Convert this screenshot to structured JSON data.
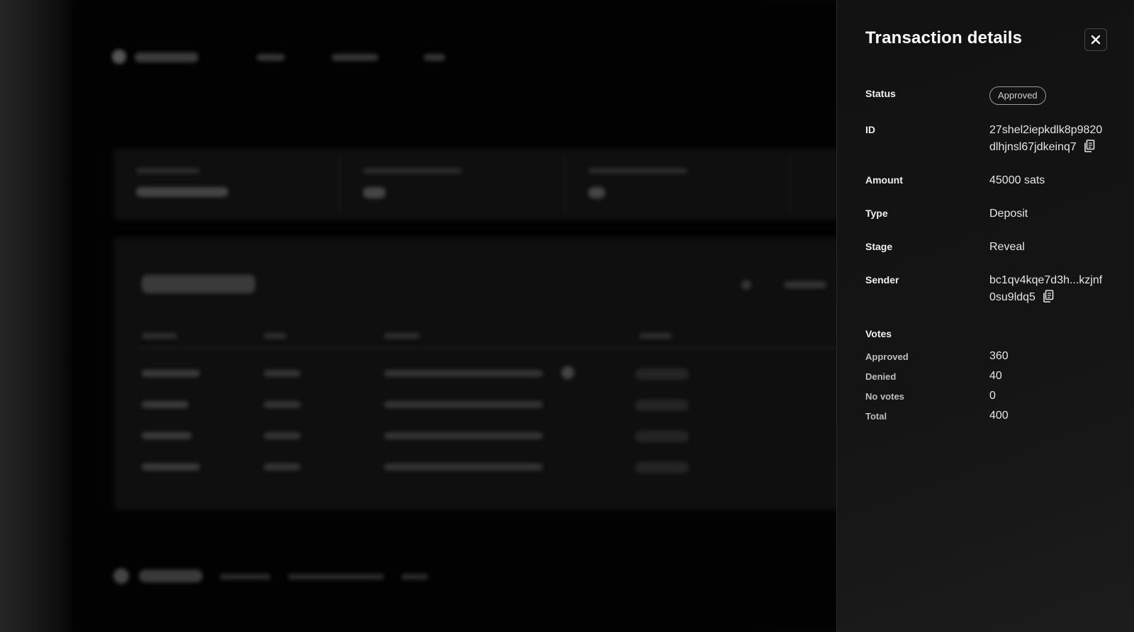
{
  "panel": {
    "title": "Transaction details",
    "close_icon": "close-icon",
    "fields": {
      "status": {
        "label": "Status",
        "value": "Approved"
      },
      "id": {
        "label": "ID",
        "value_lines": [
          "27shel2iepkdlk8p9820",
          "dlhjnsl67jdkeinq7"
        ],
        "copy_icon": "copy-icon"
      },
      "amount": {
        "label": "Amount",
        "value": "45000 sats"
      },
      "type": {
        "label": "Type",
        "value": "Deposit"
      },
      "stage": {
        "label": "Stage",
        "value": "Reveal"
      },
      "sender": {
        "label": "Sender",
        "value_lines": [
          "bc1qv4kqe7d3h...kzjnf",
          "0su9ldq5"
        ],
        "copy_icon": "copy-icon"
      }
    },
    "votes": {
      "heading": "Votes",
      "items": [
        {
          "label": "Approved",
          "value": "360"
        },
        {
          "label": "Denied",
          "value": "40"
        },
        {
          "label": "No votes",
          "value": "0"
        },
        {
          "label": "Total",
          "value": "400"
        }
      ]
    }
  }
}
